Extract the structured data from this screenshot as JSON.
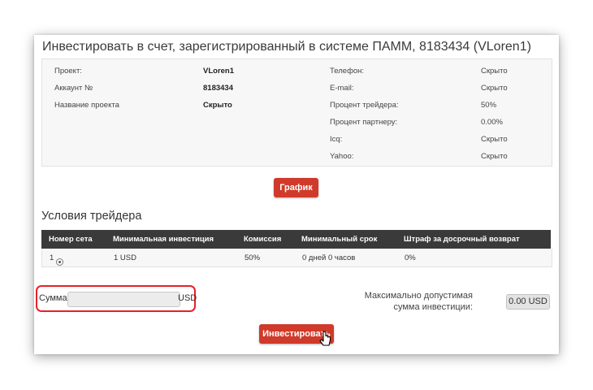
{
  "title": "Инвестировать в счет, зарегистрированный в системе ПАММ, 8183434 (VLoren1)",
  "info": {
    "left": [
      {
        "label": "Проект:",
        "value": "VLoren1"
      },
      {
        "label": "Аккаунт №",
        "value": "8183434"
      },
      {
        "label": "Название проекта",
        "value": "Скрыто"
      }
    ],
    "right": [
      {
        "label": "Телефон:",
        "value": "Скрыто"
      },
      {
        "label": "E-mail:",
        "value": "Скрыто"
      },
      {
        "label": "Процент трейдера:",
        "value": "50%"
      },
      {
        "label": "Процент партнеру:",
        "value": "0.00%"
      },
      {
        "label": "Icq:",
        "value": "Скрыто"
      },
      {
        "label": "Yahoo:",
        "value": "Скрыто"
      }
    ]
  },
  "chart_button": "График",
  "conditions": {
    "heading": "Условия трейдера",
    "columns": [
      "Номер сета",
      "Минимальная инвестиция",
      "Комиссия",
      "Минимальный срок",
      "Штраф за досрочный возврат"
    ],
    "row": {
      "set": "1",
      "min_investment": "1 USD",
      "commission": "50%",
      "min_term": "0 дней 0 часов",
      "penalty": "0%"
    }
  },
  "amount": {
    "label": "Сумма",
    "value": "",
    "currency": "USD"
  },
  "max_investment": {
    "label": "Максимально допустимая сумма инвестиции:",
    "value": "0.00 USD"
  },
  "invest_button": "Инвестировать",
  "colors": {
    "accent": "#d03a2a",
    "highlight": "#e8202a",
    "table_header": "#3a3a3a"
  }
}
